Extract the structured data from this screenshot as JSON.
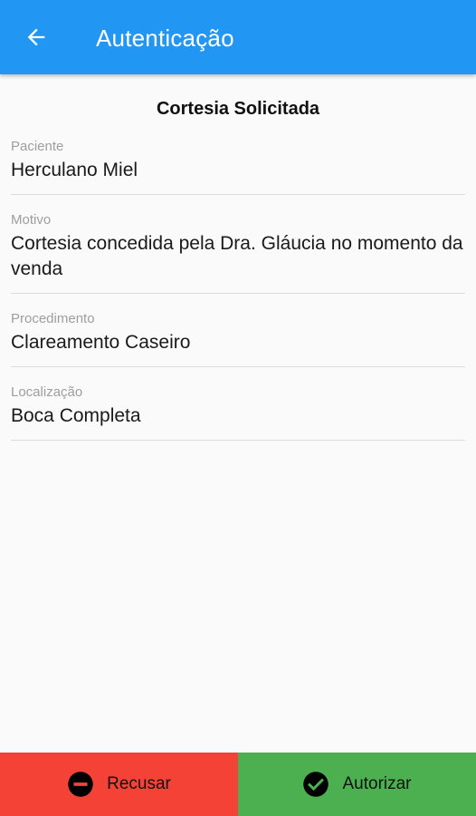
{
  "appbar": {
    "title": "Autenticação",
    "back_icon": "arrow-back-icon"
  },
  "main": {
    "heading": "Cortesia Solicitada",
    "fields": [
      {
        "label": "Paciente",
        "value": "Herculano Miel"
      },
      {
        "label": "Motivo",
        "value": "Cortesia concedida pela Dra. Gláucia no momento da venda"
      },
      {
        "label": "Procedimento",
        "value": "Clareamento Caseiro"
      },
      {
        "label": "Localização",
        "value": "Boca Completa"
      }
    ]
  },
  "actions": {
    "refuse": {
      "label": "Recusar",
      "icon": "minus-circle-icon",
      "color": "#f44336"
    },
    "approve": {
      "label": "Autorizar",
      "icon": "check-circle-icon",
      "color": "#4caf50"
    }
  },
  "colors": {
    "primary": "#2196f3",
    "background": "#fafafa"
  }
}
